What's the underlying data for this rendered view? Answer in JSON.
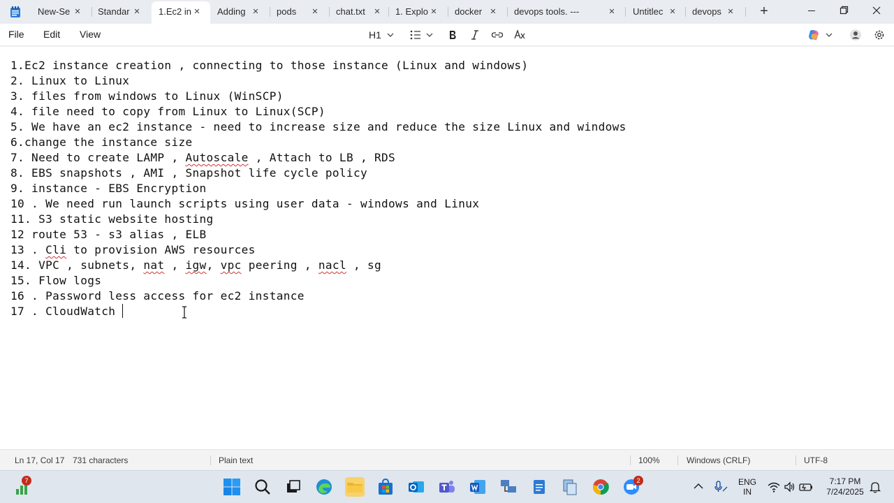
{
  "tabs": [
    {
      "label": "New-Se"
    },
    {
      "label": "Standar"
    },
    {
      "label": "1.Ec2 in",
      "active": true
    },
    {
      "label": "Adding"
    },
    {
      "label": "pods"
    },
    {
      "label": "chat.txt"
    },
    {
      "label": "1. Explo"
    },
    {
      "label": "docker"
    },
    {
      "label": "devops tools. ---"
    },
    {
      "label": "Untitlec"
    },
    {
      "label": "devops"
    }
  ],
  "menu": {
    "file": "File",
    "edit": "Edit",
    "view": "View"
  },
  "toolbar": {
    "heading": "H1"
  },
  "editor": {
    "lines": [
      "1.Ec2 instance creation , connecting to those instance (Linux and windows)",
      "2. Linux to Linux",
      "3. files from windows to Linux (WinSCP)",
      "4. file need to copy from Linux to Linux(SCP)",
      "5. We have an ec2 instance - need to increase size and reduce the size Linux and windows",
      "6.change the instance size",
      "7. Need to create LAMP , Autoscale , Attach to LB , RDS",
      "8. EBS snapshots , AMI , Snapshot life cycle policy",
      "9. instance - EBS Encryption",
      "10 . We need run launch scripts using user data - windows and Linux",
      "11. S3 static website hosting",
      "12 route 53 - s3 alias , ELB",
      "13 . Cli to provision AWS resources",
      "14. VPC , subnets, nat , igw, vpc peering , nacl , sg",
      "15. Flow logs",
      "16 . Password less access for ec2 instance",
      "17 . CloudWatch "
    ]
  },
  "status": {
    "position": "Ln 17, Col 17",
    "characters": "731 characters",
    "format": "Plain text",
    "zoom": "100%",
    "line_ending": "Windows (CRLF)",
    "encoding": "UTF-8"
  },
  "taskbar": {
    "widget_badge": "7",
    "zoom_badge": "2",
    "lang_top": "ENG",
    "lang_bottom": "IN",
    "time": "7:17 PM",
    "date": "7/24/2025"
  },
  "colors": {
    "accent": "#0067c0",
    "spell_error": "#d13438"
  }
}
